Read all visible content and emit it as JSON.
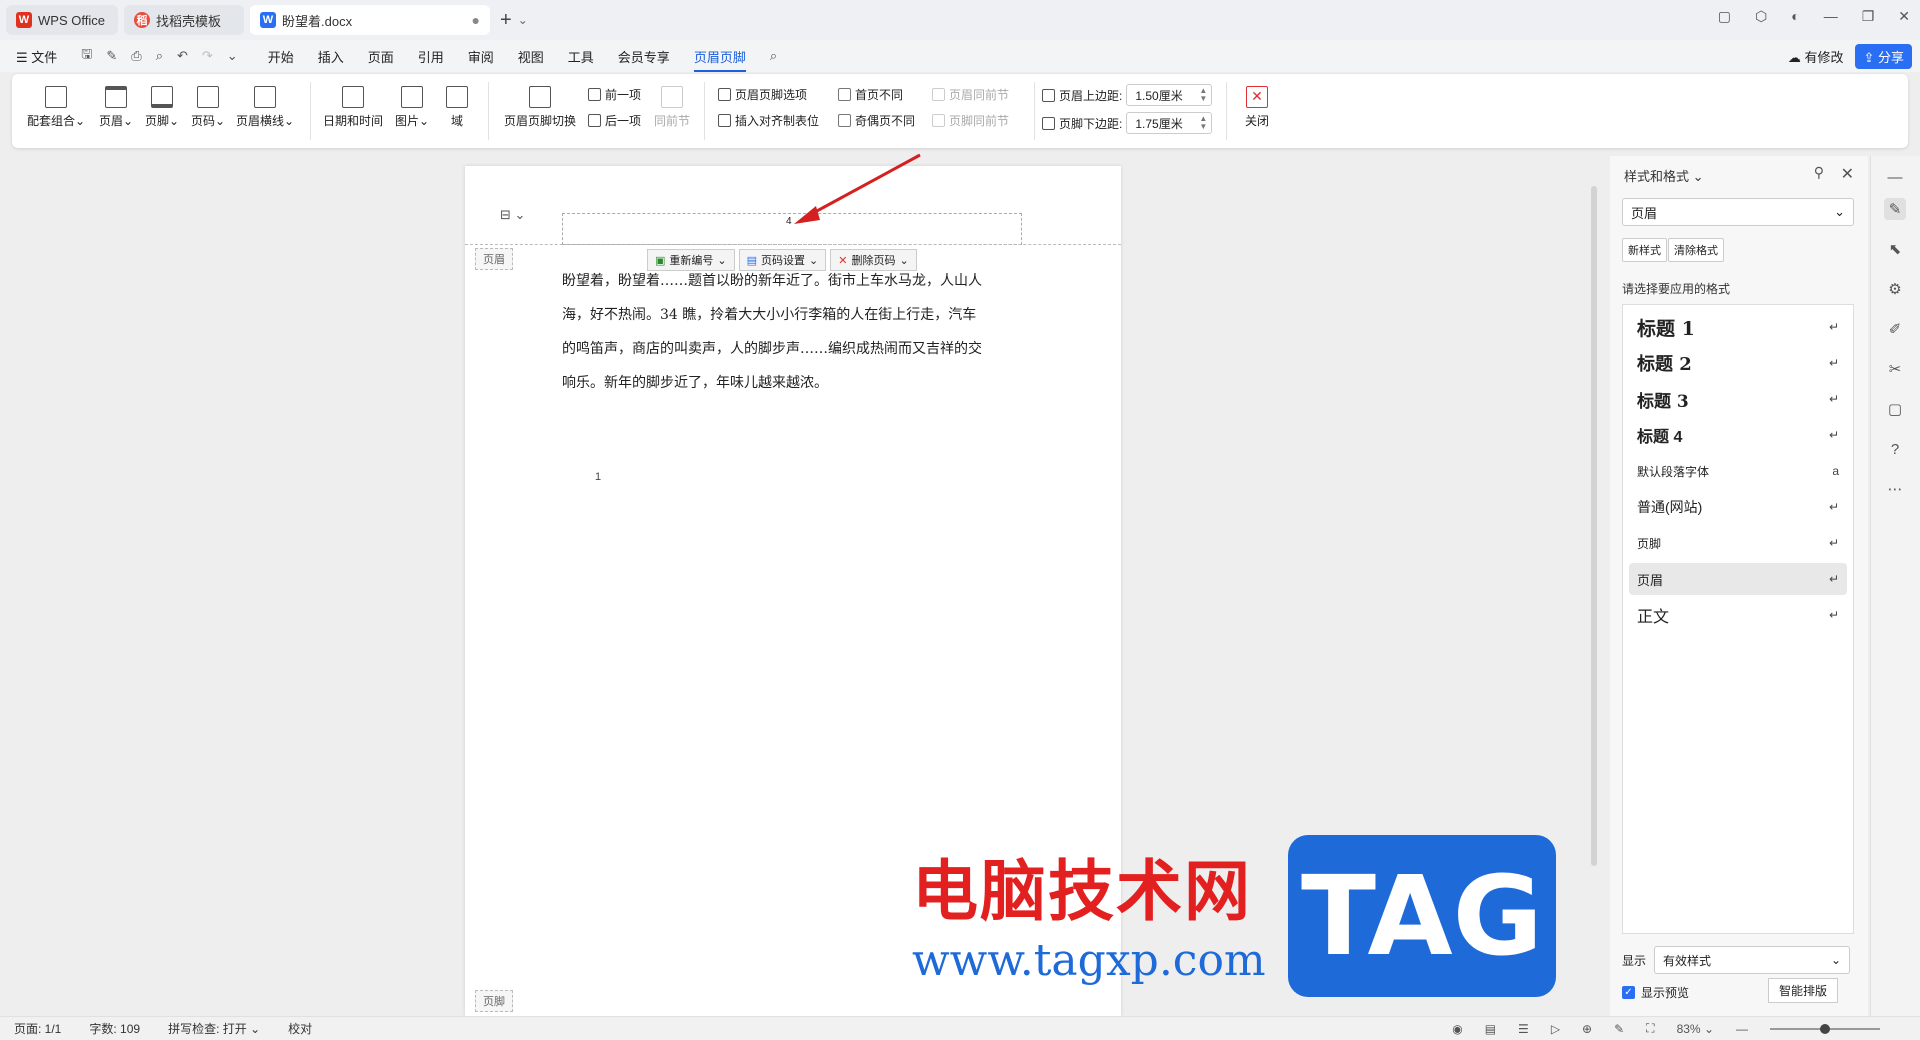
{
  "tabs": [
    {
      "label": "WPS Office"
    },
    {
      "label": "找稻壳模板"
    },
    {
      "label": "盼望着.docx"
    }
  ],
  "menubar": {
    "file": "文件",
    "items": [
      "开始",
      "插入",
      "页面",
      "引用",
      "审阅",
      "视图",
      "工具",
      "会员专享",
      "页眉页脚"
    ],
    "active": "页眉页脚",
    "modified_label": "有修改",
    "share_label": "分享"
  },
  "ribbon": {
    "big_buttons": [
      "配套组合",
      "页眉",
      "页脚",
      "页码",
      "页眉横线",
      "日期和时间",
      "图片",
      "域",
      "页眉页脚切换"
    ],
    "nav": {
      "prev": "前一项",
      "next": "后一项",
      "same_as_prev": "同前节"
    },
    "options": {
      "hf_options": "页眉页脚选项",
      "insert_align_tab": "插入对齐制表位",
      "diff_first": "首页不同",
      "diff_odd_even": "奇偶页不同",
      "header_same_prev": "页眉同前节",
      "footer_same_prev": "页脚同前节"
    },
    "margins": {
      "header_label": "页眉上边距:",
      "header_value": "1.50厘米",
      "footer_label": "页脚下边距:",
      "footer_value": "1.75厘米"
    },
    "close_label": "关闭"
  },
  "document": {
    "header_page_number": "4",
    "header_tag": "页眉",
    "footer_tag": "页脚",
    "page_number_toolbar": {
      "renumber": "重新编号",
      "settings": "页码设置",
      "delete": "删除页码"
    },
    "body_lines": [
      "盼望着，盼望着……题首以盼的新年近了。街市上车水马龙，人山人",
      "海，好不热闹。34 瞧，拎着大大小小行李箱的人在街上行走，汽车",
      "的鸣笛声，商店的叫卖声，人的脚步声……编织成热闹而又吉祥的交",
      "响乐。新年的脚步近了，年味儿越来越浓。"
    ],
    "body_number": "1"
  },
  "watermark": {
    "cn_title": "电脑技术网",
    "url": "www.tagxp.com",
    "tag": "TAG"
  },
  "panel": {
    "title": "样式和格式",
    "current_style": "页眉",
    "new_style": "新样式",
    "clear_format": "清除格式",
    "choose_label": "请选择要应用的格式",
    "styles": [
      "标题 1",
      "标题 2",
      "标题 3",
      "标题 4",
      "默认段落字体",
      "普通(网站)",
      "页脚",
      "页眉",
      "正文"
    ],
    "selected_style": "页眉",
    "show_label": "显示",
    "show_value": "有效样式",
    "preview_label": "显示预览",
    "smart_label": "智能排版"
  },
  "statusbar": {
    "page": "页面: 1/1",
    "words": "字数: 109",
    "spell": "拼写检查: 打开",
    "proof": "校对",
    "zoom": "83%"
  },
  "colors": {
    "accent": "#1a5fdc",
    "watermark_red": "#e32020",
    "watermark_blue": "#1e6ad8"
  }
}
